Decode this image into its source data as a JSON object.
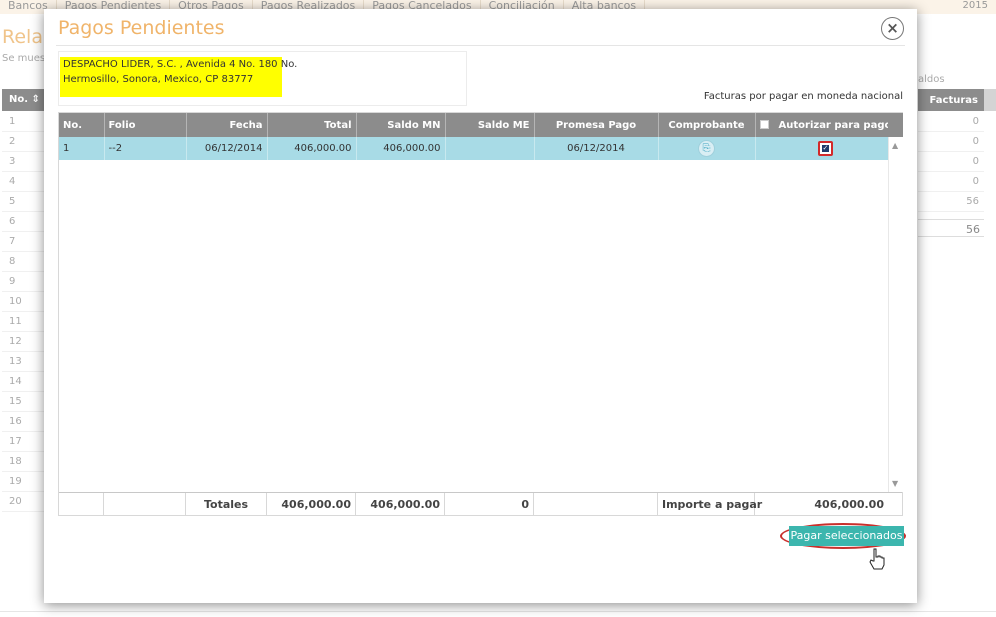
{
  "background": {
    "tabs": [
      "Bancos",
      "Pagos Pendientes",
      "Otros Pagos",
      "Pagos Realizados",
      "Pagos Cancelados",
      "Conciliación",
      "Alta bancos"
    ],
    "year": "2015",
    "title": "Relac",
    "subtitle": "Se muest",
    "saldos_label": "aldos",
    "left_header": "No.",
    "row_numbers": [
      "1",
      "2",
      "3",
      "4",
      "5",
      "6",
      "7",
      "8",
      "9",
      "10",
      "11",
      "12",
      "13",
      "14",
      "15",
      "16",
      "17",
      "18",
      "19",
      "20"
    ],
    "right_header": "Facturas",
    "right_values": [
      "0",
      "0",
      "0",
      "0",
      "56"
    ],
    "right_total": "56"
  },
  "modal": {
    "title": "Pagos Pendientes",
    "close_label": "×",
    "address_line1": "DESPACHO LIDER, S.C. , Avenida 4 No. 180 No.",
    "address_line2": "Hermosillo, Sonora, Mexico, CP 83777",
    "note": "Facturas por pagar en moneda nacional",
    "columns": {
      "no": "No.",
      "folio": "Folio",
      "fecha": "Fecha",
      "total": "Total",
      "saldo_mn": "Saldo MN",
      "saldo_me": "Saldo ME",
      "promesa": "Promesa Pago",
      "comprobante": "Comprobante",
      "autorizar": "Autorizar para pago"
    },
    "rows": [
      {
        "no": "1",
        "folio": "--2",
        "fecha": "06/12/2014",
        "total": "406,000.00",
        "saldo_mn": "406,000.00",
        "saldo_me": "",
        "promesa": "06/12/2014",
        "comprobante_icon": "pdf-icon",
        "autorizar": true
      }
    ],
    "totals": {
      "label": "Totales",
      "total": "406,000.00",
      "saldo_mn": "406,000.00",
      "saldo_me": "0",
      "importe_label": "Importe a pagar",
      "importe": "406,000.00"
    },
    "pay_button": "Pagar seleccionados"
  },
  "colors": {
    "accent_title": "#f0b46a",
    "header_gray": "#8c8c8c",
    "row_selected": "#a8dbe6",
    "highlight_yellow": "#ffff00",
    "button_teal": "#3cb6ae",
    "annotation_red": "#c9302c"
  }
}
